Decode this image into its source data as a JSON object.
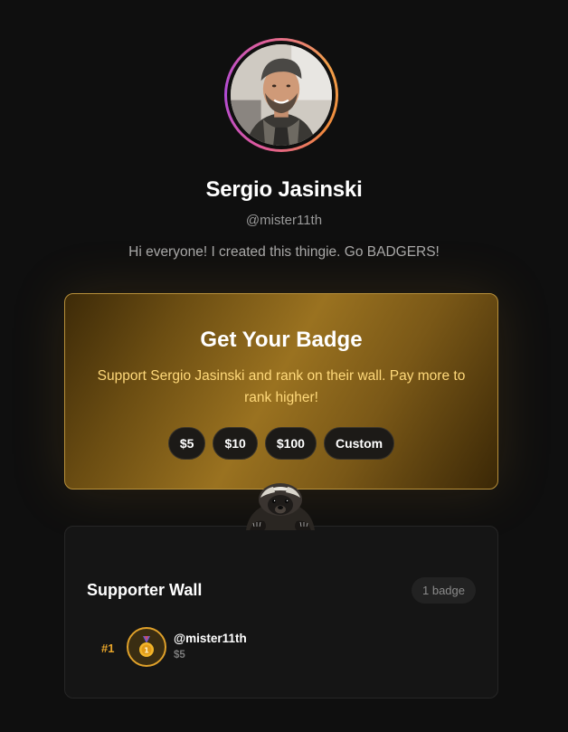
{
  "profile": {
    "name": "Sergio Jasinski",
    "handle": "@mister11th",
    "bio": "Hi everyone! I created this thingie. Go BADGERS!"
  },
  "badge_card": {
    "title": "Get Your Badge",
    "subtitle": "Support Sergio Jasinski and rank on their wall. Pay more to rank higher!",
    "amounts": [
      "$5",
      "$10",
      "$100",
      "Custom"
    ]
  },
  "wall": {
    "title": "Supporter Wall",
    "count": "1 badge",
    "supporters": [
      {
        "rank": "#1",
        "name": "@mister11th",
        "amount": "$5",
        "icon": "gold-medal-icon"
      }
    ]
  },
  "colors": {
    "background": "#0f0f0f",
    "gold_accent": "#e0a12a",
    "badge_text": "#ffd97a"
  }
}
